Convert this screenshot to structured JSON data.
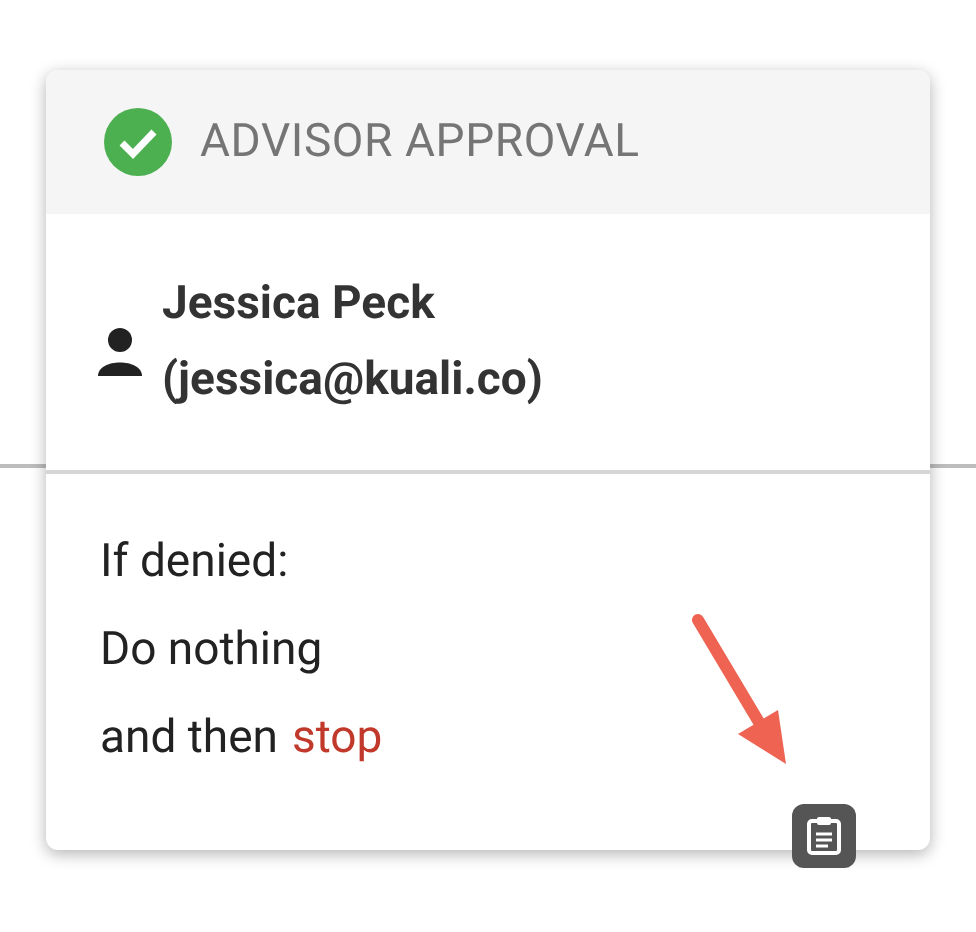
{
  "step": {
    "title": "ADVISOR APPROVAL",
    "approved": true
  },
  "approver": {
    "name": "Jessica Peck",
    "email": "(jessica@kuali.co)"
  },
  "on_denied": {
    "label": "If denied:",
    "action": "Do nothing",
    "then_prefix": "and then",
    "then_action": "stop"
  }
}
